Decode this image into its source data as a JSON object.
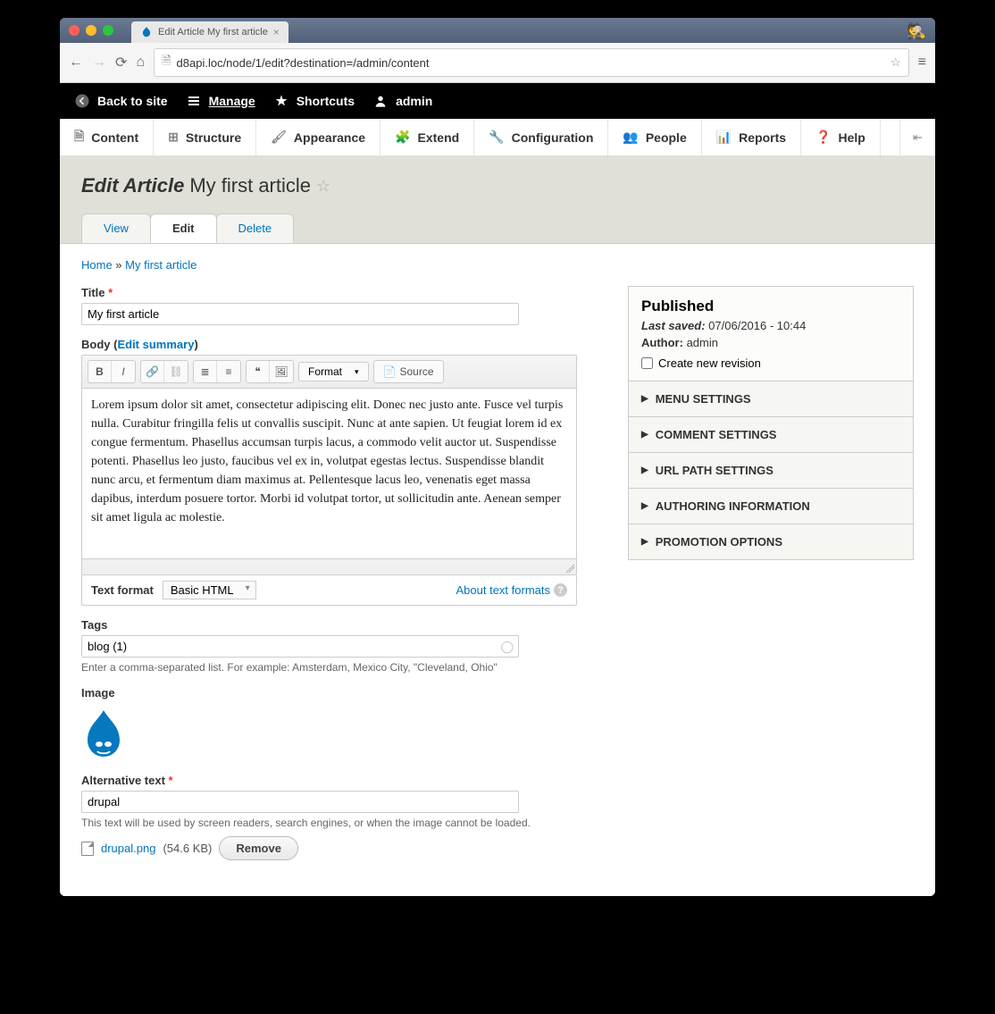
{
  "browser": {
    "tab_title": "Edit Article My first article",
    "url": "d8api.loc/node/1/edit?destination=/admin/content"
  },
  "blackbar": {
    "back": "Back to site",
    "manage": "Manage",
    "shortcuts": "Shortcuts",
    "user": "admin"
  },
  "admin_tabs": [
    "Content",
    "Structure",
    "Appearance",
    "Extend",
    "Configuration",
    "People",
    "Reports",
    "Help"
  ],
  "page_title_prefix": "Edit Article",
  "page_title": "My first article",
  "primary_tabs": {
    "view": "View",
    "edit": "Edit",
    "delete": "Delete"
  },
  "breadcrumb": {
    "home": "Home",
    "sep": " » ",
    "current": "My first article"
  },
  "form": {
    "title_label": "Title",
    "title_value": "My first article",
    "body_label": "Body",
    "edit_summary": "Edit summary",
    "body_value": "Lorem ipsum dolor sit amet, consectetur adipiscing elit. Donec nec justo ante. Fusce vel turpis nulla. Curabitur fringilla felis ut convallis suscipit. Nunc at ante sapien. Ut feugiat lorem id ex congue fermentum. Phasellus accumsan turpis lacus, a commodo velit auctor ut. Suspendisse potenti. Phasellus leo justo, faucibus vel ex in, volutpat egestas lectus. Suspendisse blandit nunc arcu, et fermentum diam maximus at. Pellentesque lacus leo, venenatis eget massa dapibus, interdum posuere tortor. Morbi id volutpat tortor, ut sollicitudin ante. Aenean semper sit amet ligula ac molestie.",
    "format_dropdown": "Format",
    "source_btn": "Source",
    "text_format_label": "Text format",
    "text_format_value": "Basic HTML",
    "about_formats": "About text formats",
    "tags_label": "Tags",
    "tags_value": "blog (1)",
    "tags_help": "Enter a comma-separated list. For example: Amsterdam, Mexico City, \"Cleveland, Ohio\"",
    "image_label": "Image",
    "alt_label": "Alternative text",
    "alt_value": "drupal",
    "alt_help": "This text will be used by screen readers, search engines, or when the image cannot be loaded.",
    "file_name": "drupal.png",
    "file_size": "(54.6 KB)",
    "remove_btn": "Remove"
  },
  "sidebar": {
    "published": "Published",
    "last_saved_label": "Last saved:",
    "last_saved_value": "07/06/2016 - 10:44",
    "author_label": "Author:",
    "author_value": "admin",
    "revision": "Create new revision",
    "accordions": [
      "MENU SETTINGS",
      "COMMENT SETTINGS",
      "URL PATH SETTINGS",
      "AUTHORING INFORMATION",
      "PROMOTION OPTIONS"
    ]
  }
}
